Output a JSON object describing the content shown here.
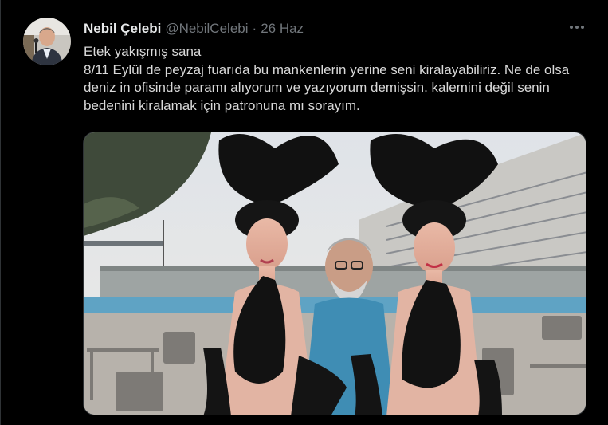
{
  "tweet": {
    "author_name": "Nebil Çelebi",
    "handle": "@NebilCelebi",
    "separator": "·",
    "time": "26 Haz",
    "more_icon": "ellipsis-icon",
    "lines": [
      "Etek yakışmış sana",
      "8/11 Eylül de peyzaj fuarıda bu mankenlerin yerine seni kiralayabiliriz. Ne de olsa deniz in ofisinde paramı alıyorum ve yazıyorum demişsin. kalemini değil senin bedenini kiralamak için patronuna mı sorayım."
    ]
  },
  "colors": {
    "background": "#000000",
    "text": "#d9d9d9",
    "name": "#e7e9ea",
    "secondary": "#71767b",
    "border": "#2f3336"
  }
}
